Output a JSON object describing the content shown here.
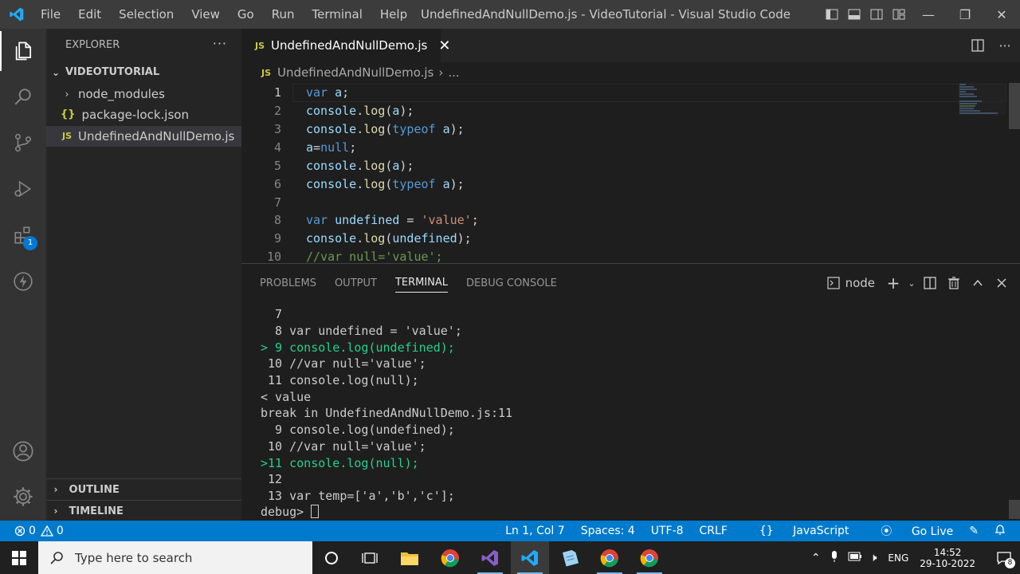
{
  "titlebar": {
    "menu": [
      "File",
      "Edit",
      "Selection",
      "View",
      "Go",
      "Run",
      "Terminal",
      "Help"
    ],
    "title": "UndefinedAndNullDemo.js - VideoTutorial - Visual Studio Code"
  },
  "activity": {
    "icons": [
      "explorer-icon",
      "search-icon",
      "source-control-icon",
      "run-debug-icon",
      "extensions-icon",
      "remote-icon",
      "accounts-icon",
      "manage-gear-icon"
    ],
    "extensions_badge": "1"
  },
  "sidebar": {
    "header": "EXPLORER",
    "more": "···",
    "folder": "VIDEOTUTORIAL",
    "items": [
      {
        "label": "node_modules",
        "icon": ">"
      },
      {
        "label": "package-lock.json",
        "icon": "{}"
      },
      {
        "label": "UndefinedAndNullDemo.js",
        "icon": "JS"
      }
    ],
    "outline": "OUTLINE",
    "timeline": "TIMELINE"
  },
  "editor": {
    "tab_label": "UndefinedAndNullDemo.js",
    "tab_icon": "JS",
    "breadcrumb_file": "UndefinedAndNullDemo.js",
    "breadcrumb_more": "...",
    "line_numbers": [
      "1",
      "2",
      "3",
      "4",
      "5",
      "6",
      "7",
      "8",
      "9",
      "10"
    ]
  },
  "panel": {
    "tabs": [
      "PROBLEMS",
      "OUTPUT",
      "TERMINAL",
      "DEBUG CONSOLE"
    ],
    "terminal_name": "node",
    "terminal_lines": [
      "  7",
      "  8 var undefined = 'value';",
      "> 9 console.log(undefined);",
      " 10 //var null='value';",
      " 11 console.log(null);",
      "< value",
      "break in UndefinedAndNullDemo.js:11",
      "  9 console.log(undefined);",
      " 10 //var null='value';",
      ">11 console.log(null);",
      " 12",
      " 13 var temp=['a','b','c'];"
    ],
    "prompt": "debug> "
  },
  "status": {
    "errors": "0",
    "warnings": "0",
    "position": "Ln 1, Col 7",
    "spaces": "Spaces: 4",
    "encoding": "UTF-8",
    "eol": "CRLF",
    "language": "JavaScript",
    "golive": "Go Live"
  },
  "taskbar": {
    "search_placeholder": "Type here to search",
    "language": "ENG",
    "time": "14:52",
    "date": "29-10-2022",
    "notifications": "8"
  },
  "colors": {
    "statusbar": "#007acc",
    "activitybar": "#333333",
    "sidebar": "#252526",
    "editor": "#1e1e1e",
    "keyword": "#569cd6",
    "function": "#dcdcaa",
    "string": "#ce9178",
    "comment": "#6a9955"
  }
}
